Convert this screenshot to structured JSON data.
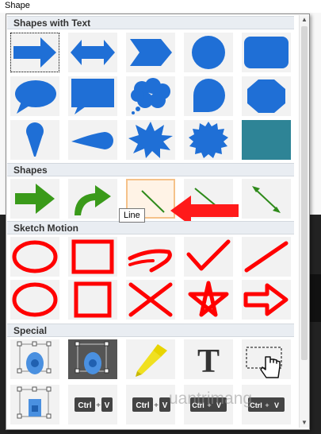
{
  "window": {
    "title": "Shape"
  },
  "sections": {
    "shapes_with_text": "Shapes with Text",
    "shapes": "Shapes",
    "sketch_motion": "Sketch Motion",
    "special": "Special"
  },
  "tooltip": "Line",
  "special_keys": {
    "ctrl": "Ctrl",
    "plus": "+",
    "v": "V",
    "t": "T"
  },
  "watermark": "uantrimang",
  "colors": {
    "shape_blue": "#1f6fd6",
    "shape_green": "#3a9a1a",
    "sketch_red": "#ff0000",
    "hover_border": "#f5c28a"
  },
  "icons": [
    "right-arrow",
    "left-right-arrow",
    "chevron-right",
    "circle",
    "rounded-rectangle",
    "speech-oval",
    "speech-rectangle",
    "thought-cloud",
    "rounded-speech",
    "octagon",
    "teardrop-pin",
    "comet",
    "burst",
    "seal",
    "teal-rectangle",
    "green-arrow",
    "curved-arrow",
    "line",
    "arrow-line",
    "double-arrow-line",
    "sketch-oval",
    "sketch-rectangle",
    "sketch-curve-arrow",
    "sketch-checkmark",
    "sketch-line",
    "sketch-oval",
    "sketch-square",
    "sketch-x",
    "sketch-star",
    "sketch-arrow",
    "blur-shape",
    "spotlight",
    "highlighter",
    "text-t",
    "hand-cursor",
    "pixelate",
    "ctrl-v",
    "ctrl-v",
    "ctrl-v",
    "ctrl-v"
  ]
}
